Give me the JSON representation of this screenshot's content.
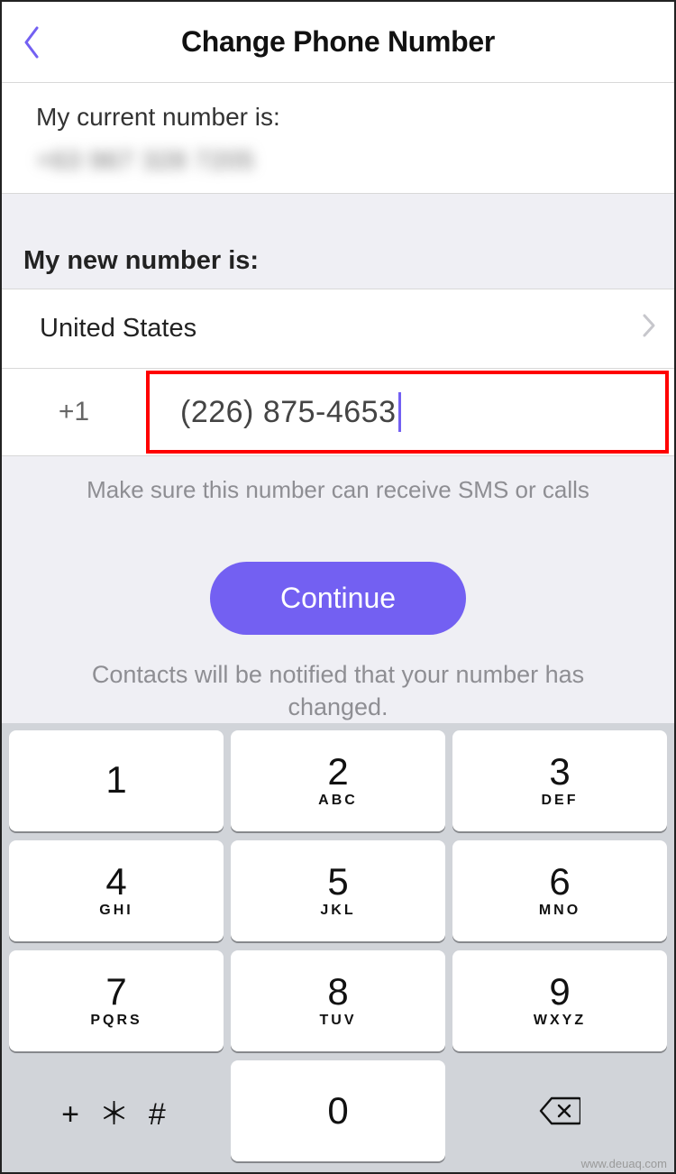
{
  "header": {
    "title": "Change Phone Number"
  },
  "current": {
    "label": "My current number is:",
    "value": "+63 967 328 7205"
  },
  "newSection": {
    "label": "My new number is:",
    "country": "United States",
    "dialCode": "+1",
    "phoneValue": "(226) 875-4653",
    "hint": "Make sure this number can receive SMS or calls",
    "continueLabel": "Continue",
    "note": "Contacts will be notified that your number has changed."
  },
  "keypad": {
    "keys": [
      {
        "d": "1",
        "l": ""
      },
      {
        "d": "2",
        "l": "ABC"
      },
      {
        "d": "3",
        "l": "DEF"
      },
      {
        "d": "4",
        "l": "GHI"
      },
      {
        "d": "5",
        "l": "JKL"
      },
      {
        "d": "6",
        "l": "MNO"
      },
      {
        "d": "7",
        "l": "PQRS"
      },
      {
        "d": "8",
        "l": "TUV"
      },
      {
        "d": "9",
        "l": "WXYZ"
      }
    ],
    "sym": "+ ＊ #",
    "zero": "0"
  },
  "watermark": "www.deuaq.com"
}
